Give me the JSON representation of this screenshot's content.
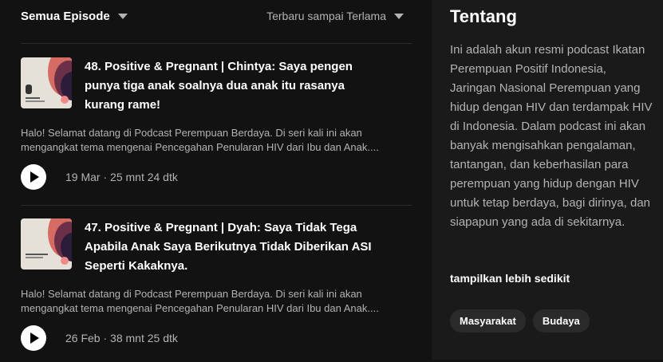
{
  "filters": {
    "episodes_label": "Semua Episode",
    "sort_label": "Terbaru sampai Terlama"
  },
  "episodes": [
    {
      "title": "48. Positive & Pregnant | Chintya: Saya pengen punya tiga anak soalnya dua anak itu rasanya kurang rame!",
      "description": "Halo! Selamat datang di Podcast Perempuan Berdaya. Di seri kali ini akan mengangkat tema mengenai Pencegahan Penularan HIV dari Ibu dan Anak....",
      "date": "19 Mar",
      "duration": "25 mnt 24 dtk"
    },
    {
      "title": "47. Positive & Pregnant | Dyah: Saya Tidak Tega Apabila Anak Saya Berikutnya Tidak Diberikan ASI Seperti Kakaknya.",
      "description": "Halo! Selamat datang di Podcast Perempuan Berdaya. Di seri kali ini akan mengangkat tema mengenai Pencegahan Penularan HIV dari Ibu dan Anak....",
      "date": "26 Feb",
      "duration": "38 mnt 25 dtk"
    }
  ],
  "about": {
    "title": "Tentang",
    "body": "Ini adalah akun resmi podcast Ikatan Perempuan Positif Indonesia, Jaringan Nasional Perempuan yang hidup dengan HIV dan terdampak HIV di Indonesia. Dalam podcast ini akan banyak mengisahkan pengalaman, tantangan, dan keberhasilan para perempuan yang hidup dengan HIV untuk tetap berdaya, bagi dirinya, dan siapapun yang ada di sekitarnya.",
    "show_less": "tampilkan lebih sedikit",
    "tags": [
      "Masyarakat",
      "Budaya"
    ]
  },
  "icons": {
    "caret": "chevron-down-icon",
    "play": "play-icon"
  },
  "colors": {
    "background": "#121212",
    "panel": "#1a1a1a",
    "muted_text": "#b3b3b3",
    "tag_bg": "#2a2a2a"
  }
}
